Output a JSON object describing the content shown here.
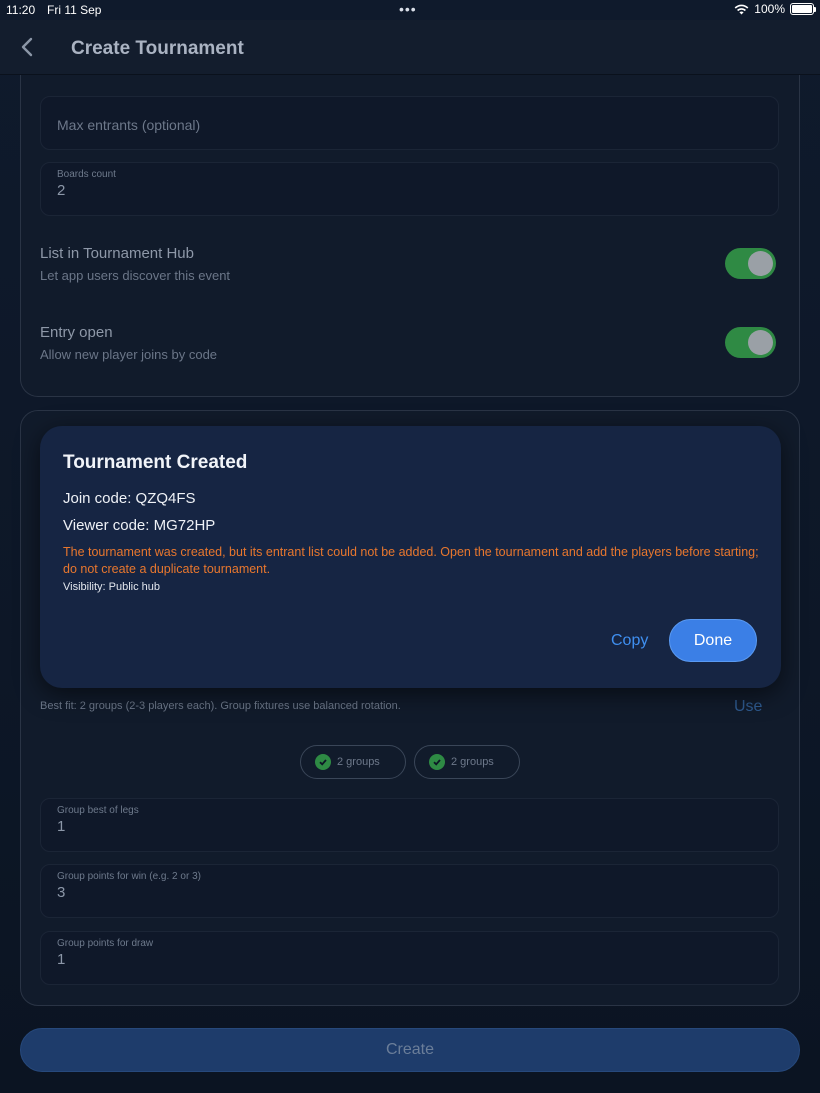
{
  "status_bar": {
    "time": "11:20",
    "date": "Fri 11 Sep",
    "dots": "•••",
    "battery": "100%"
  },
  "nav": {
    "title": "Create Tournament",
    "back_icon": "chevron-left-icon"
  },
  "settings": {
    "max_entrants_placeholder": "Max entrants (optional)",
    "boards_count_label": "Boards count",
    "boards_count_value": "2",
    "hub_title": "List in Tournament Hub",
    "hub_subtitle": "Let app users discover this event",
    "hub_enabled": true,
    "entry_title": "Entry open",
    "entry_subtitle": "Allow new player joins by code",
    "entry_enabled": true
  },
  "modal": {
    "title": "Tournament Created",
    "join_code": "Join code: QZQ4FS",
    "viewer_code": "Viewer code: MG72HP",
    "warning": "The tournament was created, but its entrant list could not be added. Open the tournament and add the players before starting; do not create a duplicate tournament.",
    "visibility": "Visibility: Public hub",
    "copy_label": "Copy",
    "done_label": "Done"
  },
  "groups": {
    "best_fit": "Best fit: 2 groups (2-3 players each). Group fixtures use balanced rotation.",
    "use_label": "Use",
    "chips": [
      "2 groups",
      "2 groups"
    ],
    "best_of_legs_label": "Group best of legs",
    "best_of_legs_value": "1",
    "points_win_label": "Group points for win (e.g. 2 or 3)",
    "points_win_value": "3",
    "points_draw_label": "Group points for draw",
    "points_draw_value": "1"
  },
  "footer": {
    "create_label": "Create"
  },
  "colors": {
    "accent": "#3b7fe6",
    "warning": "#e8772e",
    "toggle_on": "#2f8a44",
    "background": "#0d1626"
  }
}
